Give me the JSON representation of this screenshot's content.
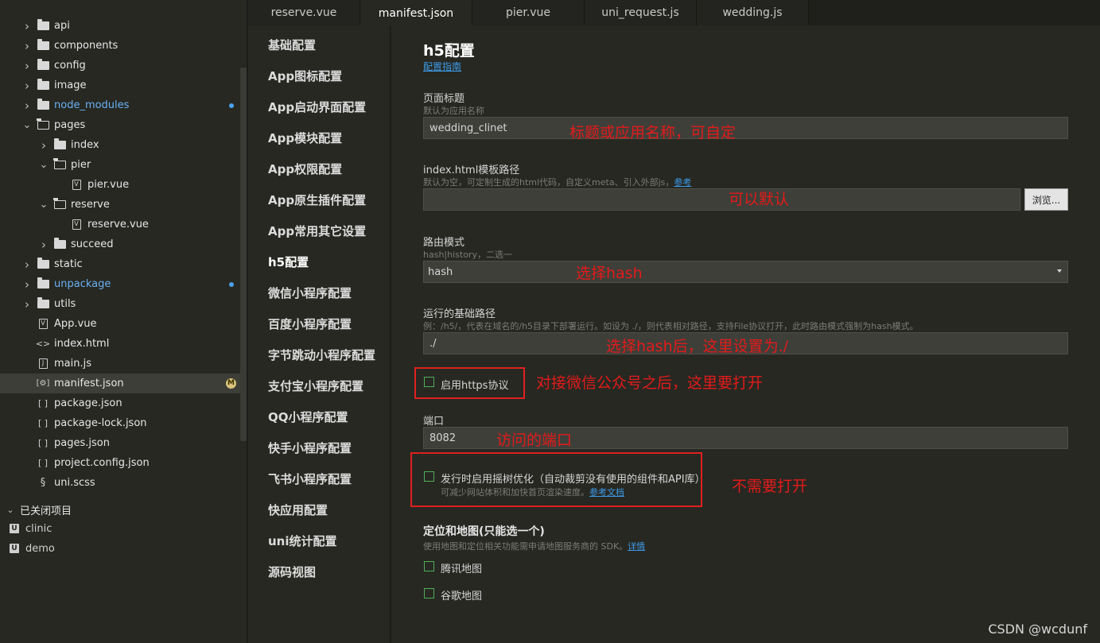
{
  "sidebar": {
    "tree": [
      {
        "label": "api",
        "type": "folder",
        "depth": 0,
        "state": "collapsed"
      },
      {
        "label": "components",
        "type": "folder",
        "depth": 0,
        "state": "collapsed"
      },
      {
        "label": "config",
        "type": "folder",
        "depth": 0,
        "state": "collapsed"
      },
      {
        "label": "image",
        "type": "folder",
        "depth": 0,
        "state": "collapsed"
      },
      {
        "label": "node_modules",
        "type": "folder",
        "depth": 0,
        "state": "collapsed",
        "modified": true
      },
      {
        "label": "pages",
        "type": "folder",
        "depth": 0,
        "state": "expanded"
      },
      {
        "label": "index",
        "type": "folder",
        "depth": 1,
        "state": "collapsed"
      },
      {
        "label": "pier",
        "type": "folder",
        "depth": 1,
        "state": "expanded"
      },
      {
        "label": "pier.vue",
        "type": "vue",
        "depth": 2
      },
      {
        "label": "reserve",
        "type": "folder",
        "depth": 1,
        "state": "expanded"
      },
      {
        "label": "reserve.vue",
        "type": "vue",
        "depth": 2
      },
      {
        "label": "succeed",
        "type": "folder",
        "depth": 1,
        "state": "collapsed"
      },
      {
        "label": "static",
        "type": "folder",
        "depth": 0,
        "state": "collapsed"
      },
      {
        "label": "unpackage",
        "type": "folder",
        "depth": 0,
        "state": "collapsed",
        "modified": true
      },
      {
        "label": "utils",
        "type": "folder",
        "depth": 0,
        "state": "collapsed"
      },
      {
        "label": "App.vue",
        "type": "vue",
        "depth": 0
      },
      {
        "label": "index.html",
        "type": "html",
        "depth": 0
      },
      {
        "label": "main.js",
        "type": "js",
        "depth": 0
      },
      {
        "label": "manifest.json",
        "type": "manifest",
        "depth": 0,
        "selected": true,
        "badge": "M"
      },
      {
        "label": "package.json",
        "type": "json",
        "depth": 0
      },
      {
        "label": "package-lock.json",
        "type": "json",
        "depth": 0
      },
      {
        "label": "pages.json",
        "type": "json",
        "depth": 0
      },
      {
        "label": "project.config.json",
        "type": "json",
        "depth": 0
      },
      {
        "label": "uni.scss",
        "type": "scss",
        "depth": 0
      }
    ],
    "closed_projects_label": "已关闭项目",
    "closed_projects": [
      "clinic",
      "demo"
    ]
  },
  "tabs": [
    {
      "label": "reserve.vue",
      "active": false
    },
    {
      "label": "manifest.json",
      "active": true
    },
    {
      "label": "pier.vue",
      "active": false
    },
    {
      "label": "uni_request.js",
      "active": false
    },
    {
      "label": "wedding.js",
      "active": false
    }
  ],
  "settings_nav": [
    "基础配置",
    "App图标配置",
    "App启动界面配置",
    "App模块配置",
    "App权限配置",
    "App原生插件配置",
    "App常用其它设置",
    "h5配置",
    "微信小程序配置",
    "百度小程序配置",
    "字节跳动小程序配置",
    "支付宝小程序配置",
    "QQ小程序配置",
    "快手小程序配置",
    "飞书小程序配置",
    "快应用配置",
    "uni统计配置",
    "源码视图"
  ],
  "settings_nav_active": 7,
  "main": {
    "title": "h5配置",
    "guide_link": "配置指南",
    "page_title": {
      "label": "页面标题",
      "hint": "默认为应用名称",
      "value": "wedding_clinet"
    },
    "template_path": {
      "label": "index.html模板路径",
      "hint": "默认为空，可定制生成的html代码，自定义meta、引入外部js，",
      "hint_link": "参考",
      "value": "",
      "browse_button": "浏览..."
    },
    "router_mode": {
      "label": "路由模式",
      "hint": "hash|history，二选一",
      "value": "hash"
    },
    "base_path": {
      "label": "运行的基础路径",
      "hint": "例：/h5/，代表在域名的/h5目录下部署运行。如设为 ./，则代表相对路径，支持File协议打开，此时路由模式强制为hash模式。",
      "value": "./"
    },
    "https": {
      "label": "启用https协议",
      "checked": false
    },
    "port": {
      "label": "端口",
      "value": "8082"
    },
    "tree_shaking": {
      "label": "发行时启用摇树优化（自动裁剪没有使用的组件和API库）",
      "hint": "可减少网站体积和加快首页渲染速度。",
      "hint_link": "参考文档",
      "checked": false
    },
    "maps": {
      "title": "定位和地图(只能选一个)",
      "hint": "使用地图和定位相关功能需申请地图服务商的 SDK。",
      "hint_link": "详情",
      "options": [
        {
          "label": "腾讯地图",
          "checked": false
        },
        {
          "label": "谷歌地图",
          "checked": false
        }
      ]
    }
  },
  "annotations": {
    "page_title": "标题或应用名称，可自定",
    "template": "可以默认",
    "router": "选择hash",
    "base_path": "选择hash后，这里设置为./",
    "https": "对接微信公众号之后，这里要打开",
    "port": "访问的端口",
    "tree_shaking": "不需要打开"
  },
  "watermark": "CSDN @wcdunf"
}
